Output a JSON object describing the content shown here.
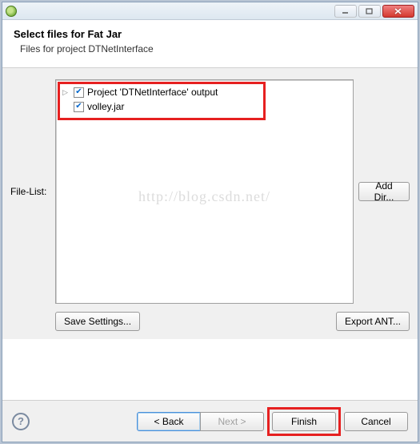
{
  "header": {
    "title": "Select files for Fat Jar",
    "subtitle": "Files for project DTNetInterface"
  },
  "fileList": {
    "label": "File-List:",
    "items": [
      {
        "label": "Project 'DTNetInterface' output",
        "checked": true,
        "expandable": true
      },
      {
        "label": "volley.jar",
        "checked": true,
        "expandable": false
      }
    ]
  },
  "buttons": {
    "addDir": "Add Dir...",
    "saveSettings": "Save Settings...",
    "exportAnt": "Export ANT...",
    "back": "<  Back",
    "next": "Next  >",
    "finish": "Finish",
    "cancel": "Cancel"
  },
  "watermark": "http://blog.csdn.net/"
}
